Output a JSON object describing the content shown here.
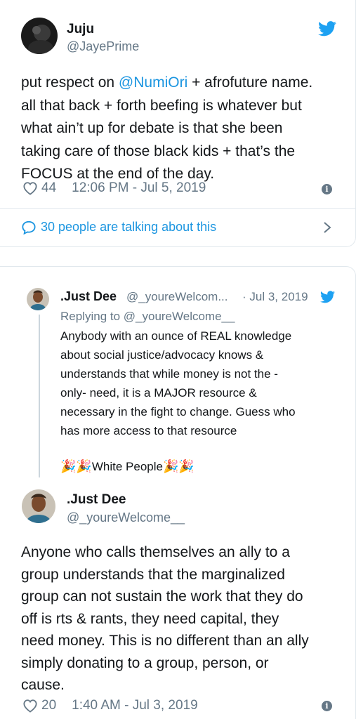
{
  "tweet1": {
    "name": "Juju",
    "handle": "@JayePrime",
    "text_before": "put respect on ",
    "mention": "@NumiOri",
    "text_line1_rest": " + afrofuture name.",
    "text_line2": "all that back + forth beefing is whatever but",
    "text_line3": "what ain’t up for debate is that she been",
    "text_line4": "taking care of those black kids + that’s the",
    "text_line5": "FOCUS at the end of the day.",
    "likes": "44",
    "timestamp": "12:06 PM - Jul 5, 2019",
    "talking": "30 people are talking about this"
  },
  "quoted": {
    "name": ".Just Dee",
    "handle": "@_youreWelcom...",
    "date": "· Jul 3, 2019",
    "replying": "Replying to @_youreWelcome__",
    "lines": [
      "Anybody with an ounce of REAL knowledge",
      "about social justice/advocacy knows &",
      "understands that while money is not the -",
      "only- need, it is a MAJOR resource &",
      "necessary in the fight to change. Guess who",
      "has more access to that resource"
    ],
    "emoji_line_text": "White People",
    "emoji": "🎉"
  },
  "tweet2": {
    "name": ".Just Dee",
    "handle": "@_youreWelcome__",
    "lines": [
      "Anyone who calls themselves an ally to a",
      "group understands that the marginalized",
      "group can not sustain the work that they do",
      "off is rts & rants, they need capital, they",
      "need money. This is no different than an ally",
      "simply donating to a group, person, or",
      "cause."
    ],
    "likes": "20",
    "timestamp": "1:40 AM - Jul 3, 2019"
  },
  "colors": {
    "twitter_blue": "#1da1f2",
    "link_blue": "#1b95e0",
    "gray": "#657786",
    "border": "#e1e8ed"
  },
  "icons": [
    "twitter-bird-icon",
    "heart-icon",
    "info-icon",
    "speech-bubble-icon",
    "chevron-right-icon"
  ]
}
